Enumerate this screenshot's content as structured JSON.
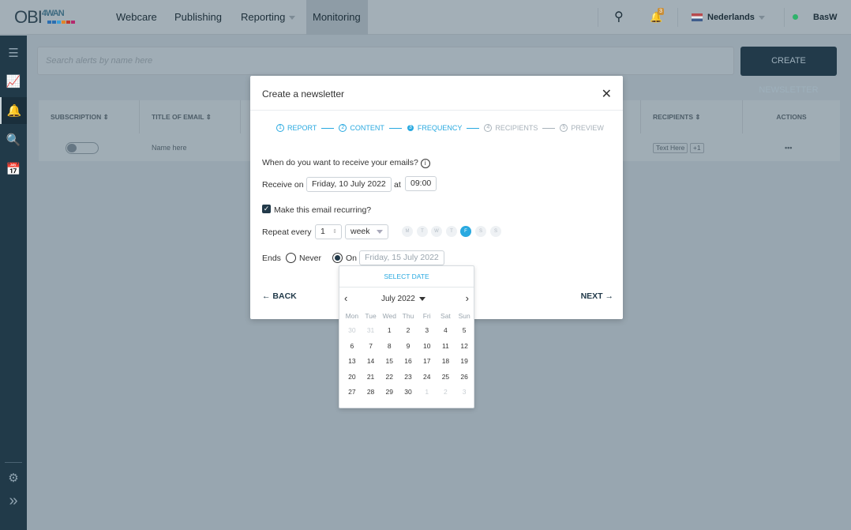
{
  "nav": {
    "logo": "OBI",
    "logo_sub": "4WAN",
    "items": [
      "Webcare",
      "Publishing",
      "Reporting",
      "Monitoring"
    ],
    "active": "Monitoring",
    "notification_count": "3",
    "language": "Nederlands",
    "user": "BasW",
    "status_color": "#2fb36b"
  },
  "search": {
    "placeholder": "Search alerts by name  here"
  },
  "create_button": "CREATE NEWSLETTER",
  "table": {
    "headers": [
      "SUBSCRIPTION",
      "TITLE OF EMAIL",
      "RECIPIENTS",
      "ACTIONS"
    ],
    "row": {
      "subscription_on": false,
      "title": "Name here",
      "recipient": "Text Here",
      "more": "+1",
      "actions": "•••"
    }
  },
  "modal": {
    "title": "Create a newsletter",
    "steps": [
      {
        "n": "1",
        "label": "REPORT"
      },
      {
        "n": "2",
        "label": "CONTENT"
      },
      {
        "n": "3",
        "label": "FREQUENCY"
      },
      {
        "n": "4",
        "label": "RECIPIENTS"
      },
      {
        "n": "5",
        "label": "PREVIEW"
      }
    ],
    "question": "When do you want to receive your emails?",
    "receive_label": "Receive on",
    "receive_date": "Friday, 10 July 2022",
    "at_label": "at",
    "time": "09:00",
    "recurring_label": "Make this email recurring?",
    "recurring": true,
    "repeat_label": "Repeat every",
    "repeat_n": "1",
    "repeat_unit": "week",
    "weekdays": [
      "M",
      "T",
      "W",
      "T",
      "F",
      "S",
      "S"
    ],
    "selected_weekday": 4,
    "ends_label": "Ends",
    "never_label": "Never",
    "on_label": "On",
    "end_date": "Friday, 15 July 2022",
    "back": "BACK",
    "next": "NEXT"
  },
  "calendar": {
    "header": "SELECT DATE",
    "month": "July 2022",
    "weekdays": [
      "Mon",
      "Tue",
      "Wed",
      "Thu",
      "Fri",
      "Sat",
      "Sun"
    ],
    "days": [
      "30",
      "31",
      "1",
      "2",
      "3",
      "4",
      "5",
      "6",
      "7",
      "8",
      "9",
      "10",
      "11",
      "12",
      "13",
      "14",
      "15",
      "16",
      "17",
      "18",
      "19",
      "20",
      "21",
      "22",
      "23",
      "24",
      "25",
      "26",
      "27",
      "28",
      "29",
      "30",
      "1",
      "2",
      "3"
    ],
    "muted_indices": [
      0,
      1,
      32,
      33,
      34
    ]
  },
  "colors": {
    "accent": "#29a9e0",
    "dark": "#223a4a"
  }
}
